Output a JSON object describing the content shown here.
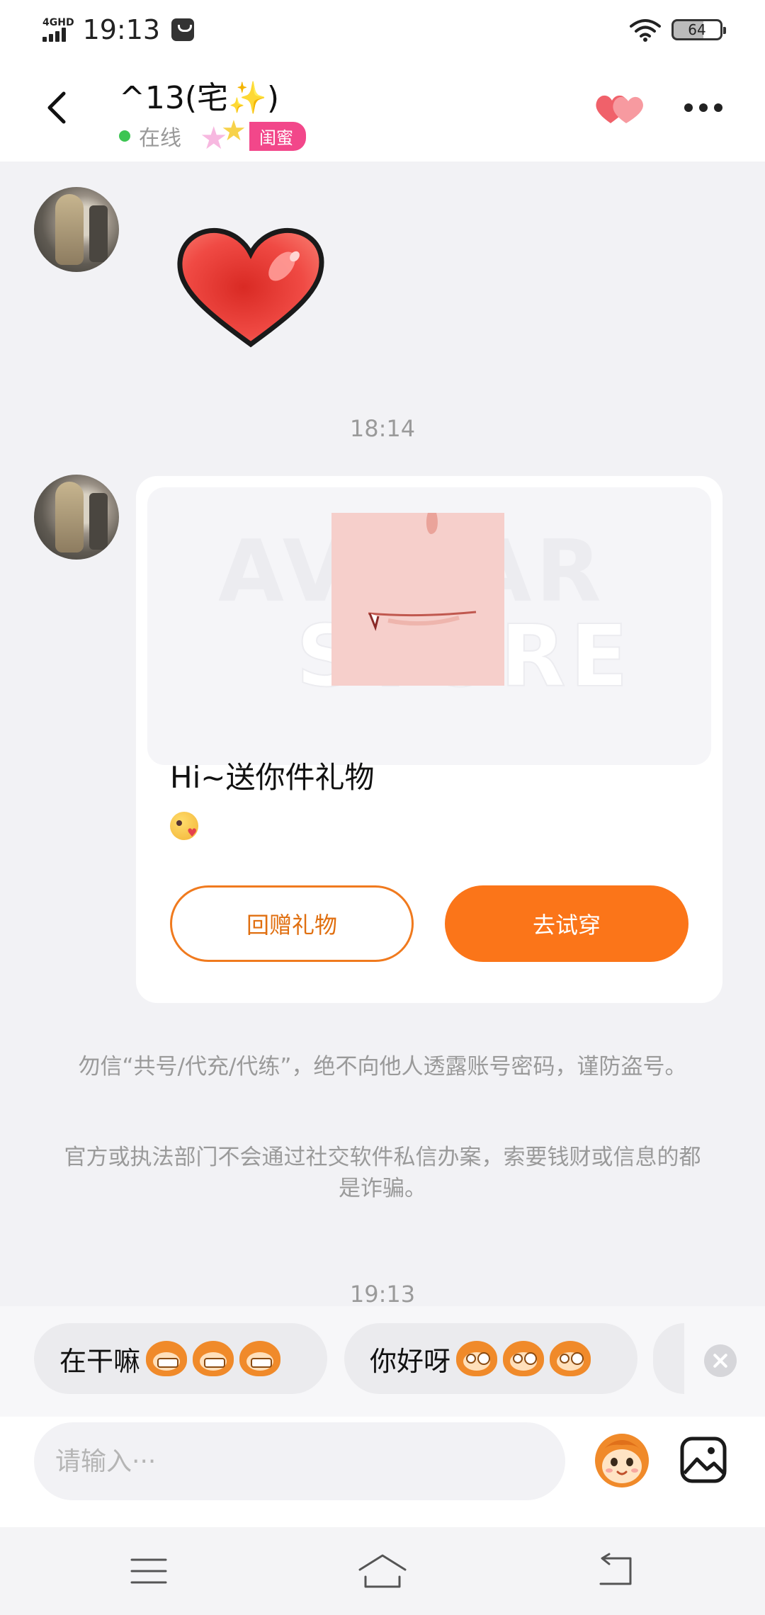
{
  "status_bar": {
    "network": "4GHD",
    "time": "19:13",
    "battery": "64"
  },
  "header": {
    "name": "^13(宅",
    "name_sparkle": "✨",
    "name_close": ")",
    "status": "在线",
    "tag": "闺蜜"
  },
  "chat": {
    "time_1": "18:14",
    "gift_card": {
      "watermark_1": "AVATAR",
      "watermark_2": "STORE",
      "title": "Hi~送你件礼物",
      "return_button": "回赠礼物",
      "try_button": "去试穿"
    },
    "notice_1": "勿信“共号/代充/代练”，绝不向他人透露账号密码，谨防盗号。",
    "notice_2": "官方或执法部门不会通过社交软件私信办案，索要钱财或信息的都是诈骗。",
    "time_2": "19:13"
  },
  "quick_replies": [
    {
      "text": "在干嘛",
      "emoji": "monkey-grin"
    },
    {
      "text": "你好呀",
      "emoji": "monkey-blush"
    }
  ],
  "input": {
    "placeholder": "请输入···"
  },
  "colors": {
    "accent": "#fb7519",
    "tag": "#f2478a",
    "online": "#3cc552"
  }
}
